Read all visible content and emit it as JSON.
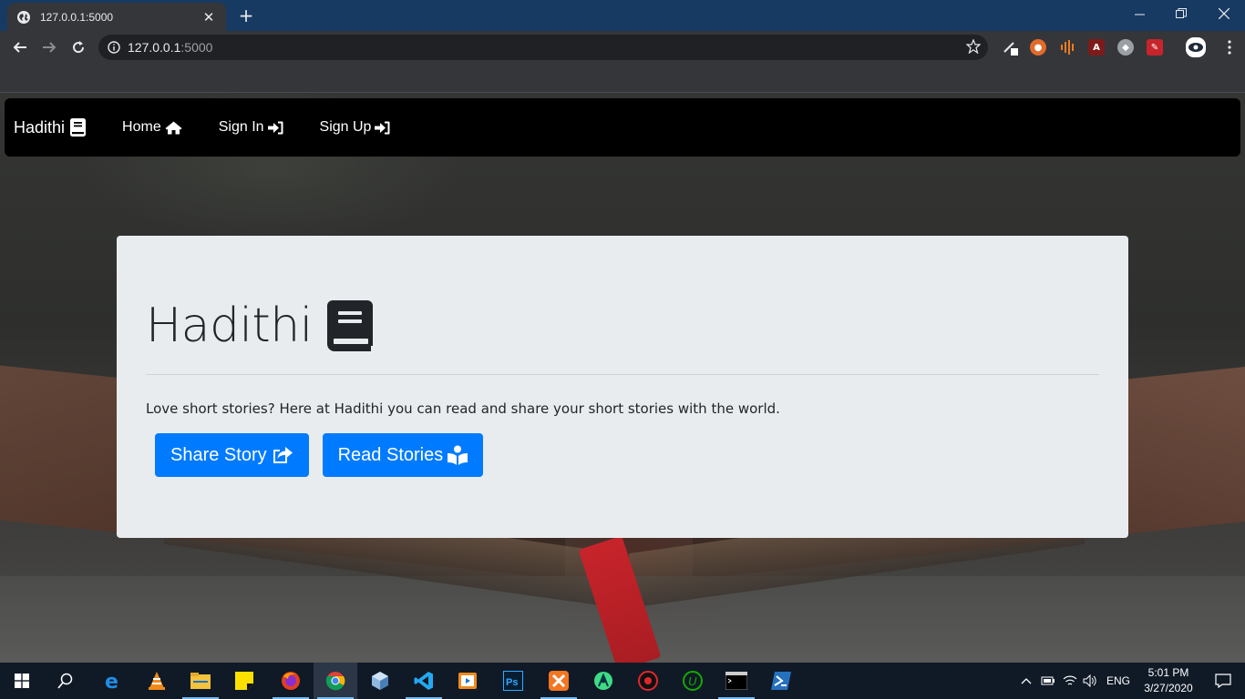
{
  "browser": {
    "tab_title": "127.0.0.1:5000",
    "url_host": "127.0.0.1",
    "url_port": ":5000"
  },
  "site": {
    "brand": "Hadithi",
    "nav": [
      {
        "label": "Home",
        "icon": "home-icon"
      },
      {
        "label": "Sign In",
        "icon": "sign-in-icon"
      },
      {
        "label": "Sign Up",
        "icon": "sign-in-icon"
      }
    ]
  },
  "hero": {
    "title": "Hadithi",
    "lead": "Love short stories? Here at Hadithi you can read and share your short stories with the world.",
    "buttons": [
      {
        "label": "Share Story",
        "icon": "share-square-icon"
      },
      {
        "label": "Read Stories",
        "icon": "book-reader-icon"
      }
    ]
  },
  "taskbar": {
    "language": "ENG",
    "time": "5:01 PM",
    "date": "3/27/2020"
  },
  "colors": {
    "primary": "#007bff",
    "navbar": "#000000",
    "jumbotron": "#e9ecef",
    "titlebar": "#173a63"
  }
}
